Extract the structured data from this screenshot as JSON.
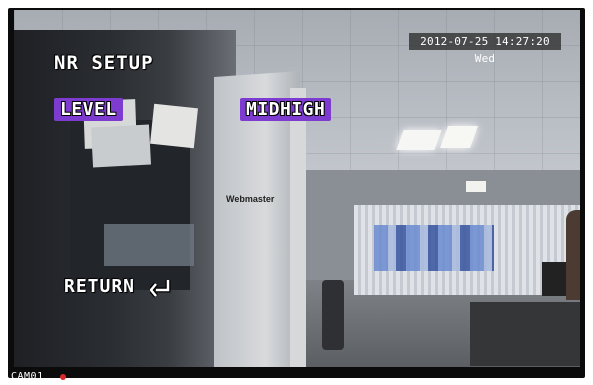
{
  "osd": {
    "timestamp": "2012-07-25 14:27:20 Wed",
    "title": "NR SETUP",
    "level_label": "LEVEL",
    "level_value": "MIDHIGH",
    "return_label": "RETURN",
    "camera_label": "CAM01"
  },
  "background": {
    "sign_text": "Webmaster"
  },
  "colors": {
    "highlight": "#7e3bd0",
    "osd_text": "#ffffff",
    "record_indicator": "#d8282a"
  },
  "icons": {
    "return": "return-arrow-icon",
    "record": "record-indicator-icon"
  }
}
